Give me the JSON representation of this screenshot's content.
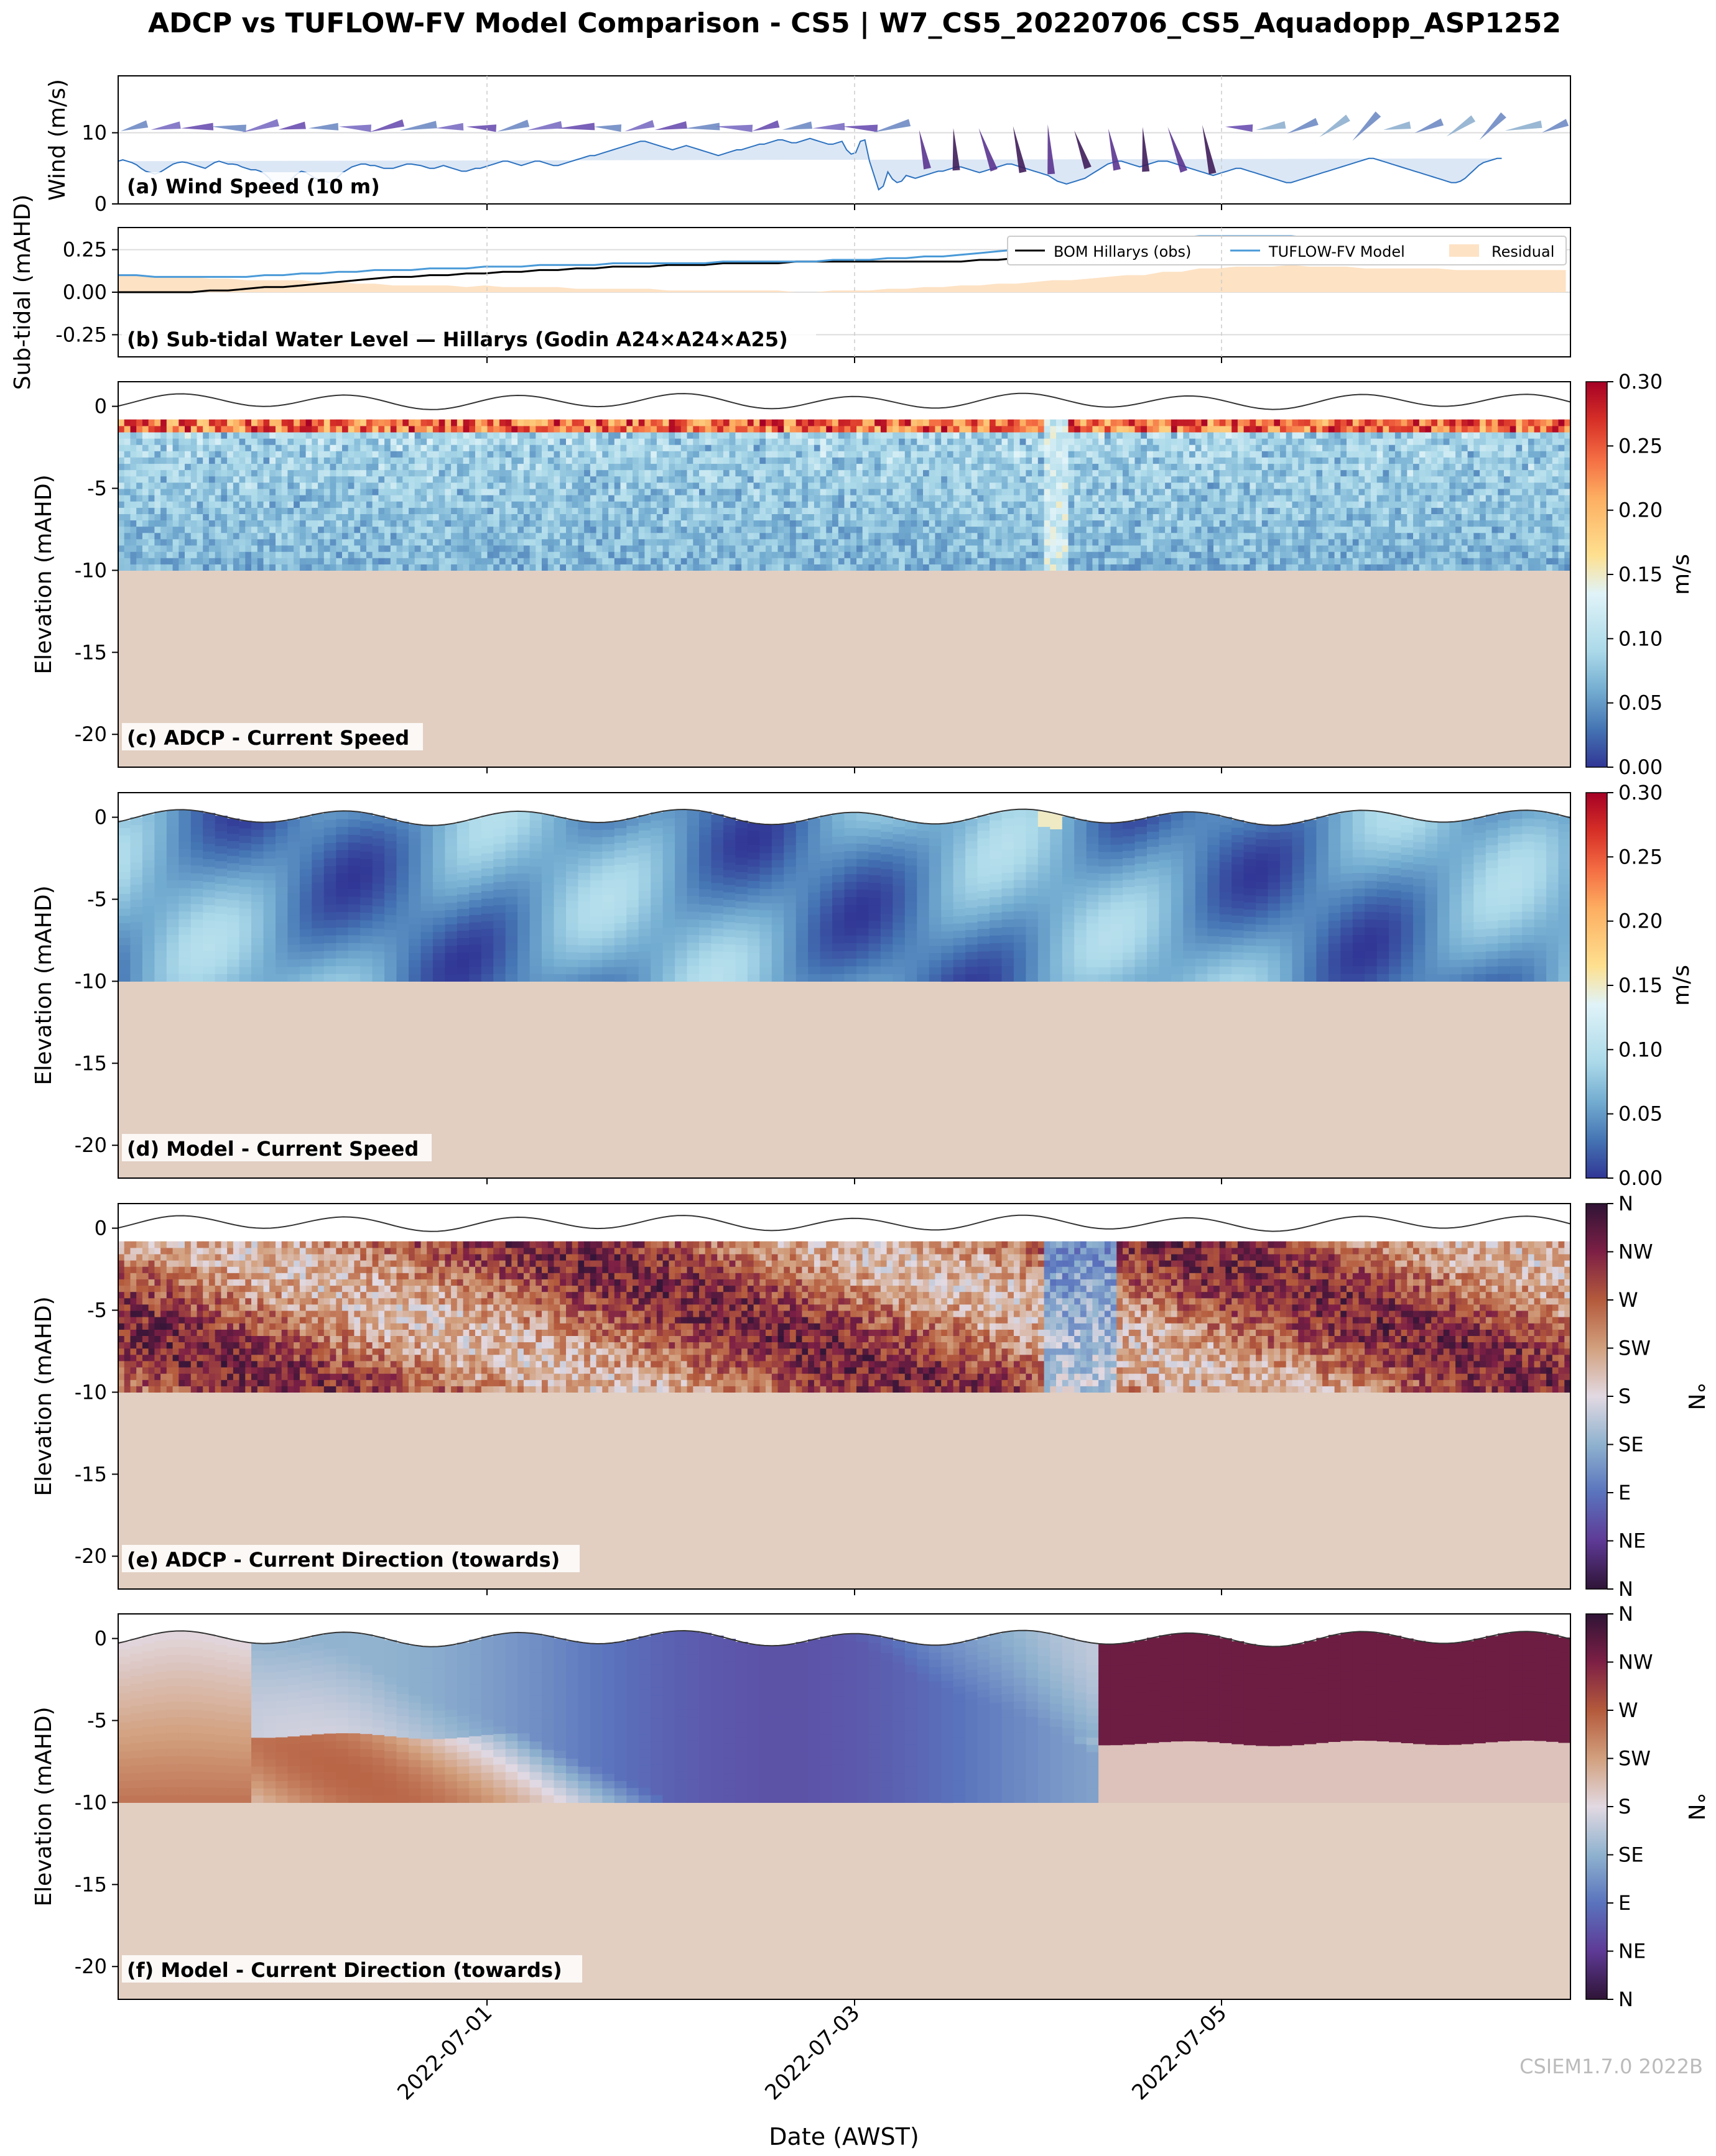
{
  "figure": {
    "title": "ADCP vs TUFLOW-FV Model Comparison - CS5 | W7_CS5_20220706_CS5_Aquadopp_ASP1252",
    "xlabel": "Date (AWST)",
    "xticks": [
      "2022-07-01",
      "2022-07-03",
      "2022-07-05"
    ],
    "watermark": "CSIEM1.7.0 2022B"
  },
  "colors": {
    "wind_fill": "#dce7f5",
    "wind_line": "#2c72c0",
    "obs_line": "#000000",
    "model_line": "#4a9ad8",
    "residual_fill": "#fde2c4",
    "seabed": "#e2cfc2",
    "surface_line": "#333333"
  },
  "chart_data": [
    {
      "type": "line",
      "label": "(a) Wind Speed (10 m)",
      "ylabel": "Wind (m/s)",
      "ylim": [
        0,
        18
      ],
      "yticks": [
        "0",
        "10"
      ],
      "x_days": [
        -2,
        -1.5,
        -1,
        -0.5,
        0,
        0.5,
        1,
        1.5,
        2,
        2.5,
        3,
        3.5,
        4,
        4.5,
        5,
        5.5,
        6,
        6.5,
        7,
        7.5,
        8,
        8.5,
        9,
        9.5,
        10,
        10.5,
        11,
        11.5,
        12,
        12.5,
        13,
        13.5,
        14,
        14.5,
        15,
        15.5,
        16,
        16.5,
        17,
        17.5,
        18,
        18.5,
        19,
        19.5,
        20,
        20.5,
        21,
        21.5,
        22,
        22.5,
        23,
        23.5,
        24,
        24.5,
        25,
        25.5,
        26,
        26.5,
        27,
        27.5,
        28,
        28.5,
        29,
        29.5,
        30,
        30.5,
        31,
        31.5,
        32,
        32.5,
        33,
        33.5,
        34,
        34.5,
        35,
        35.5,
        36,
        36.5,
        37,
        37.5,
        38,
        38.5,
        39,
        39.5,
        40,
        40.5,
        41,
        41.5,
        42,
        42.5,
        43,
        43.5,
        44,
        44.5,
        45,
        45.5,
        46,
        46.5,
        47,
        47.5,
        48,
        48.5,
        49,
        49.5,
        50,
        50.5,
        51,
        51.5,
        52,
        52.5,
        53,
        53.5,
        54,
        54.5,
        55,
        55.5,
        56,
        56.5,
        57,
        57.5,
        58,
        58.5,
        59,
        59.5,
        60,
        60.5,
        61,
        61.5,
        62,
        62.5,
        63,
        63.5,
        64,
        64.5,
        65,
        65.5,
        66,
        66.5,
        67,
        67.5,
        68,
        68.5,
        69,
        69.5,
        70,
        70.5,
        71,
        71.5,
        72,
        72.5,
        73,
        73.5,
        74,
        74.5,
        75,
        75.5,
        76,
        76.5,
        77,
        77.5,
        78,
        78.5,
        79,
        79.5,
        80,
        80.5,
        81,
        81.5,
        82,
        82.5,
        83,
        83.5,
        84,
        84.5,
        85,
        85.5,
        86,
        86.5,
        87,
        87.5,
        88,
        88.5,
        89,
        89.5,
        90,
        90.5,
        91,
        91.5,
        92,
        92.5,
        93,
        93.5,
        94,
        94.5,
        95,
        95.5,
        96,
        96.5,
        97,
        97.5,
        98,
        98.5,
        99,
        99.5,
        100,
        100.5,
        101,
        101.5,
        102,
        102.5,
        103,
        103.5,
        104,
        104.5,
        105,
        105.5,
        106,
        106.5,
        107,
        107.5,
        108,
        108.5,
        109,
        109.5,
        110,
        110.5,
        111,
        111.5,
        112,
        112.5,
        113,
        113.5,
        114,
        114.5,
        115,
        115.5,
        116,
        116.5,
        117,
        117.5,
        118,
        118.5,
        119,
        119.5,
        120,
        120.5,
        121,
        121.5,
        122,
        122.5,
        123,
        123.5,
        124,
        124.5,
        125,
        125.5,
        126,
        126.5,
        127,
        127.5,
        128,
        128.5,
        129,
        129.5,
        130,
        130.5,
        131,
        131.5,
        132,
        132.5,
        133,
        133.5,
        134,
        134.5,
        135,
        135.5,
        136,
        136.5,
        137,
        137.5,
        138,
        138.5,
        139,
        139.5,
        140,
        140.5,
        141,
        141.5,
        142,
        142.5,
        143,
        143.5,
        144,
        144.5,
        145,
        145.5,
        146,
        146.5,
        147,
        147.5,
        148,
        148.5,
        149,
        149.5,
        150,
        150.5,
        151,
        151.5,
        152,
        152.5,
        153,
        153.5,
        154,
        154.5,
        155,
        155.5,
        156,
        156.5
      ],
      "speed": [
        6.0,
        6.2,
        6.0,
        5.8,
        5.5,
        5.0,
        4.6,
        4.4,
        4.2,
        4.4,
        4.8,
        5.2,
        5.6,
        5.8,
        5.9,
        5.8,
        5.6,
        5.4,
        5.2,
        5.0,
        5.4,
        5.8,
        6.0,
        5.8,
        5.6,
        5.6,
        5.5,
        5.2,
        5.0,
        4.8,
        4.8,
        4.6,
        4.2,
        3.6,
        2.8,
        2.0,
        1.4,
        2.6,
        3.6,
        4.2,
        4.6,
        4.4,
        4.0,
        3.6,
        3.4,
        3.2,
        3.0,
        3.2,
        3.8,
        4.4,
        4.8,
        5.2,
        5.4,
        5.6,
        5.6,
        5.4,
        5.4,
        5.2,
        5.0,
        5.0,
        5.0,
        5.2,
        5.4,
        5.6,
        5.6,
        5.5,
        5.4,
        5.2,
        5.0,
        5.0,
        5.2,
        5.4,
        5.2,
        5.0,
        4.8,
        4.6,
        4.6,
        4.8,
        5.0,
        5.0,
        5.2,
        5.4,
        5.6,
        5.8,
        6.0,
        6.0,
        5.8,
        5.6,
        5.4,
        5.6,
        5.8,
        6.0,
        6.0,
        5.8,
        5.6,
        5.4,
        5.4,
        5.6,
        5.8,
        6.0,
        6.2,
        6.4,
        6.6,
        6.8,
        6.8,
        7.0,
        7.2,
        7.4,
        7.6,
        7.8,
        8.0,
        8.2,
        8.4,
        8.6,
        8.8,
        8.8,
        8.6,
        8.4,
        8.2,
        8.0,
        7.8,
        7.6,
        7.8,
        8.0,
        8.2,
        8.0,
        7.8,
        7.6,
        7.4,
        7.2,
        7.0,
        6.8,
        7.0,
        7.2,
        7.4,
        7.6,
        7.6,
        7.8,
        8.0,
        8.2,
        8.4,
        8.4,
        8.6,
        8.8,
        9.0,
        9.0,
        8.8,
        8.6,
        8.6,
        8.8,
        9.0,
        9.2,
        9.0,
        8.8,
        8.6,
        8.4,
        8.4,
        8.6,
        8.8,
        7.6,
        7.0,
        7.2,
        8.8,
        9.0,
        6.0,
        4.0,
        2.0,
        2.5,
        4.5,
        3.5,
        3.0,
        3.2,
        4.0,
        3.8,
        3.6,
        3.8,
        4.0,
        4.2,
        4.4,
        4.6,
        4.6,
        4.8,
        5.0,
        5.2,
        5.2,
        5.0,
        4.8,
        4.6,
        4.4,
        4.6,
        4.8,
        5.0,
        5.2,
        5.4,
        5.6,
        5.6,
        5.4,
        5.2,
        5.0,
        4.8,
        4.6,
        4.4,
        4.2,
        4.0,
        3.6,
        3.2,
        3.0,
        2.8,
        3.0,
        3.2,
        3.4,
        3.6,
        4.0,
        4.4,
        4.8,
        5.2,
        5.6,
        5.8,
        6.0,
        6.0,
        5.8,
        5.6,
        5.4,
        5.2,
        5.4,
        5.6,
        5.8,
        6.0,
        6.0,
        6.0,
        5.8,
        5.6,
        5.4,
        5.2,
        5.0,
        4.8,
        4.6,
        4.4,
        4.2,
        4.0,
        4.2,
        4.4,
        4.6,
        4.8,
        5.0,
        5.0,
        4.8,
        4.6,
        4.4,
        4.2,
        4.0,
        3.8,
        3.6,
        3.4,
        3.2,
        3.0,
        3.0,
        3.2,
        3.4,
        3.6,
        3.8,
        4.0,
        4.2,
        4.4,
        4.6,
        4.8,
        5.0,
        5.2,
        5.4,
        5.6,
        5.8,
        6.0,
        6.2,
        6.4,
        6.4,
        6.2,
        6.0,
        5.8,
        5.6,
        5.4,
        5.2,
        5.0,
        4.8,
        4.6,
        4.4,
        4.2,
        4.0,
        3.8,
        3.6,
        3.4,
        3.2,
        3.0,
        3.0,
        3.2,
        3.6,
        4.2,
        4.8,
        5.4,
        5.8,
        6.0,
        6.2,
        6.4,
        6.4
      ],
      "arrows_note": "wind direction glyphs drawn along the panel; longer and darker glyphs where stronger"
    },
    {
      "type": "line",
      "label": "(b) Sub-tidal Water Level — Hillarys (Godin A24×A24×A25)",
      "ylabel": "Sub-tidal (mAHD)",
      "ylim": [
        -0.38,
        0.38
      ],
      "yticks": [
        "0.25",
        "0.00",
        "-0.25"
      ],
      "x_days": [
        -2,
        0,
        2,
        4,
        6,
        8,
        10,
        12,
        14,
        16,
        18,
        20,
        22,
        24,
        26,
        28,
        30,
        32,
        34,
        36,
        38,
        40,
        42,
        44,
        46,
        48,
        50,
        52,
        54,
        56,
        58,
        60,
        62,
        64,
        66,
        68,
        70,
        72,
        74,
        76,
        78,
        80,
        82,
        84,
        86,
        88,
        90,
        92,
        94,
        96,
        98,
        100,
        102,
        104,
        106,
        108,
        110,
        112,
        114,
        116,
        118,
        120,
        122,
        124,
        126,
        128,
        130,
        132,
        134,
        136,
        138,
        140,
        142,
        144,
        146,
        148,
        150,
        152,
        154,
        156
      ],
      "series": [
        {
          "name": "BOM Hillarys (obs)",
          "values": [
            0.0,
            0.0,
            0.0,
            0.0,
            0.0,
            0.01,
            0.01,
            0.02,
            0.03,
            0.03,
            0.04,
            0.05,
            0.06,
            0.07,
            0.08,
            0.09,
            0.09,
            0.1,
            0.1,
            0.11,
            0.11,
            0.12,
            0.12,
            0.13,
            0.13,
            0.14,
            0.14,
            0.15,
            0.15,
            0.15,
            0.16,
            0.16,
            0.16,
            0.17,
            0.17,
            0.17,
            0.17,
            0.18,
            0.18,
            0.18,
            0.18,
            0.18,
            0.18,
            0.18,
            0.18,
            0.18,
            0.18,
            0.19,
            0.19,
            0.2,
            0.2,
            0.2,
            0.21,
            0.21,
            0.21,
            0.21,
            0.21,
            0.2,
            0.2,
            0.19,
            0.19,
            0.18,
            0.18,
            0.18,
            0.17,
            0.17,
            0.17,
            0.17,
            0.17,
            0.17,
            0.17,
            0.17,
            0.17,
            0.17,
            0.17,
            0.17,
            0.17,
            0.17,
            0.17,
            0.17
          ]
        },
        {
          "name": "TUFLOW-FV Model",
          "values": [
            0.1,
            0.1,
            0.09,
            0.09,
            0.09,
            0.09,
            0.09,
            0.09,
            0.1,
            0.1,
            0.11,
            0.11,
            0.12,
            0.12,
            0.13,
            0.13,
            0.13,
            0.14,
            0.14,
            0.14,
            0.15,
            0.15,
            0.15,
            0.16,
            0.16,
            0.16,
            0.16,
            0.17,
            0.17,
            0.17,
            0.17,
            0.17,
            0.17,
            0.18,
            0.18,
            0.18,
            0.18,
            0.18,
            0.18,
            0.19,
            0.19,
            0.19,
            0.2,
            0.2,
            0.21,
            0.21,
            0.22,
            0.23,
            0.24,
            0.25,
            0.26,
            0.27,
            0.28,
            0.29,
            0.3,
            0.31,
            0.31,
            0.32,
            0.32,
            0.33,
            0.33,
            0.33,
            0.33,
            0.33,
            0.33,
            0.32,
            0.32,
            0.32,
            0.31,
            0.31,
            0.31,
            0.31,
            0.31,
            0.3,
            0.3,
            0.3,
            0.3,
            0.3,
            0.3,
            0.3
          ]
        },
        {
          "name": "Residual"
        }
      ],
      "legend": "top-right"
    },
    {
      "type": "heatmap",
      "label": "(c) ADCP - Current Speed",
      "ylabel": "Elevation (mAHD)",
      "ylim": [
        -22,
        1.5
      ],
      "yticks": [
        "0",
        "-5",
        "-10",
        "-15",
        "-20"
      ],
      "colorbar": {
        "label": "m/s",
        "range": [
          0,
          0.3
        ],
        "ticks": [
          "0.30",
          "0.25",
          "0.20",
          "0.15",
          "0.10",
          "0.05",
          "0.00"
        ],
        "colormap": "RdYlBu_r"
      },
      "seabed_elevation": -10,
      "surface_elevation_range": [
        -0.5,
        0.5
      ],
      "surface_bins_speed": 0.3
    },
    {
      "type": "heatmap",
      "label": "(d) Model - Current Speed",
      "ylabel": "Elevation (mAHD)",
      "ylim": [
        -22,
        1.5
      ],
      "yticks": [
        "0",
        "-5",
        "-10",
        "-15",
        "-20"
      ],
      "colorbar": {
        "label": "m/s",
        "range": [
          0,
          0.3
        ],
        "ticks": [
          "0.30",
          "0.25",
          "0.20",
          "0.15",
          "0.10",
          "0.05",
          "0.00"
        ],
        "colormap": "RdYlBu_r"
      },
      "seabed_elevation": -10
    },
    {
      "type": "heatmap",
      "label": "(e) ADCP - Current Direction (towards)",
      "ylabel": "Elevation (mAHD)",
      "ylim": [
        -22,
        1.5
      ],
      "yticks": [
        "0",
        "-5",
        "-10",
        "-15",
        "-20"
      ],
      "colorbar": {
        "label": "°N",
        "ticks": [
          "N",
          "NW",
          "W",
          "SW",
          "S",
          "SE",
          "E",
          "NE",
          "N"
        ],
        "colormap": "twilight_shifted"
      },
      "seabed_elevation": -10
    },
    {
      "type": "heatmap",
      "label": "(f) Model - Current Direction (towards)",
      "ylabel": "Elevation (mAHD)",
      "ylim": [
        -22,
        1.5
      ],
      "yticks": [
        "0",
        "-5",
        "-10",
        "-15",
        "-20"
      ],
      "colorbar": {
        "label": "°N",
        "ticks": [
          "N",
          "NW",
          "W",
          "SW",
          "S",
          "SE",
          "E",
          "NE",
          "N"
        ],
        "colormap": "twilight_shifted"
      },
      "seabed_elevation": -10
    }
  ]
}
